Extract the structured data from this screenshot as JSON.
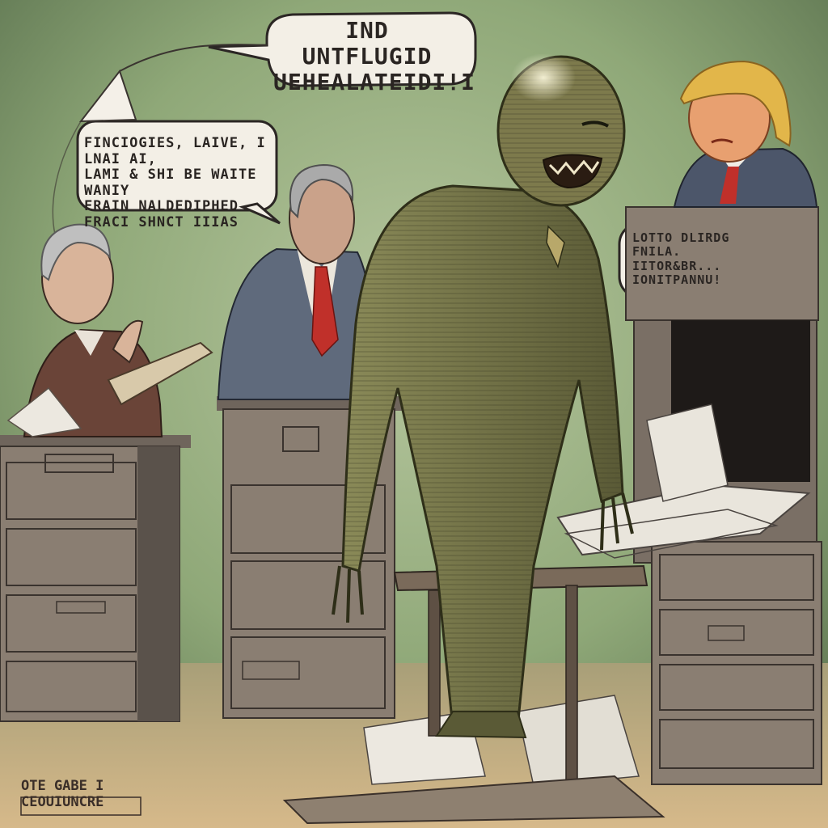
{
  "bubbles": {
    "top": "IND UNTFLUGID\nUEHEALATEIDI!I",
    "left": "FINCIOGIES, LAIVE, I LNAI AI,\nLAMI & SHI BE WAITE WANIY\nFRAIN NALDEDIPHED\nFRACI SHNCT IIIAS",
    "right": "LOTTO DLIRDG\nFNILA. IITOR&BR...\nIONITPANNU!"
  },
  "signature": "OTE GABE I\nCEOUIUNCRE",
  "colors": {
    "background": "#6f8a5f",
    "floor": "#c9ad7a",
    "suit_gray": "#5f6a7c",
    "suit_brown": "#6a4438",
    "tie_red": "#c0302a",
    "monster": "#6b6a42",
    "hair_blonde": "#e2b64a",
    "cabinet": "#8a7e72"
  }
}
